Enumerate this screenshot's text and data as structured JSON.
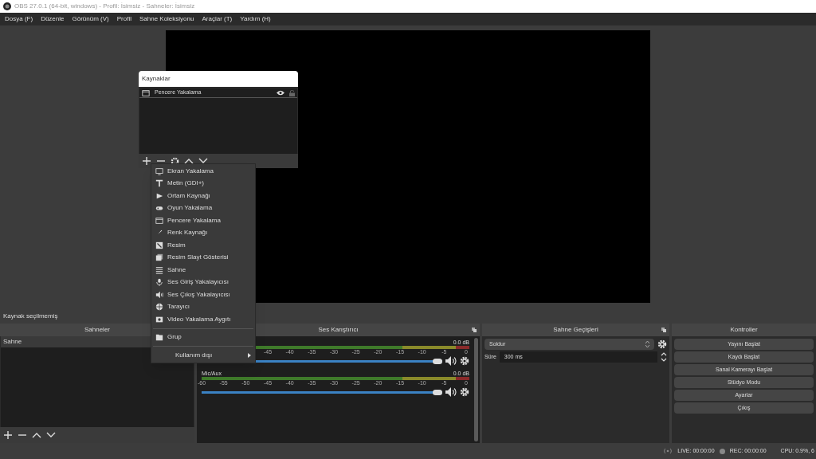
{
  "window": {
    "title": "OBS 27.0.1 (64-bit, windows) - Profil: İsimsiz - Sahneler: İsimsiz"
  },
  "menu_bar": [
    "Dosya (F)",
    "Düzenle",
    "Görünüm (V)",
    "Profil",
    "Sahne Koleksiyonu",
    "Araçlar (T)",
    "Yardım (H)"
  ],
  "sources_dock": {
    "title": "Kaynaklar",
    "items": [
      {
        "label": "Pencere Yakalama",
        "kind": "window",
        "visible": true,
        "locked": false
      }
    ]
  },
  "add_source_menu": {
    "items": [
      {
        "label": "Ekran Yakalama",
        "kind": "monitor"
      },
      {
        "label": "Metin (GDI+)",
        "kind": "text"
      },
      {
        "label": "Ortam Kaynağı",
        "kind": "play"
      },
      {
        "label": "Oyun Yakalama",
        "kind": "gamepad"
      },
      {
        "label": "Pencere Yakalama",
        "kind": "window"
      },
      {
        "label": "Renk Kaynağı",
        "kind": "brush"
      },
      {
        "label": "Resim",
        "kind": "image"
      },
      {
        "label": "Resim Slayt Gösterisi",
        "kind": "slides"
      },
      {
        "label": "Sahne",
        "kind": "list"
      },
      {
        "label": "Ses Giriş Yakalayıcısı",
        "kind": "mic"
      },
      {
        "label": "Ses Çıkış Yakalayıcısı",
        "kind": "speaker"
      },
      {
        "label": "Tarayıcı",
        "kind": "globe"
      },
      {
        "label": "Video Yakalama Aygıtı",
        "kind": "camera"
      },
      {
        "label": "Grup",
        "kind": "folder",
        "separator_before": true
      },
      {
        "label": "Kullanım dışı",
        "kind": "submenu",
        "separator_before": true
      }
    ]
  },
  "source_status": "Kaynak seçilmemiş",
  "scenes": {
    "title": "Sahneler",
    "items": [
      {
        "label": "Sahne",
        "selected": true
      }
    ]
  },
  "mixer": {
    "title": "Ses Karıştırıcı",
    "tracks": [
      {
        "peak": "0.0 dB",
        "ticks": [
          "-45",
          "-40",
          "-35",
          "-30",
          "-25",
          "-20",
          "-15",
          "-10",
          "-5",
          "0"
        ],
        "level": 1,
        "muted": false
      },
      {
        "name": "Mic/Aux",
        "peak": "0.0 dB",
        "ticks": [
          "-60",
          "-55",
          "-50",
          "-45",
          "-40",
          "-35",
          "-30",
          "-25",
          "-20",
          "-15",
          "-10",
          "-5",
          "0"
        ],
        "level": 1,
        "muted": false
      }
    ]
  },
  "transitions": {
    "title": "Sahne Geçişleri",
    "transition": "Soldur",
    "duration_label": "Süre",
    "duration": "300 ms"
  },
  "controls": {
    "title": "Kontroller",
    "buttons": [
      "Yayını Başlat",
      "Kaydı Başlat",
      "Sanal Kamerayı Başlat",
      "Stüdyo Modu",
      "Ayarlar",
      "Çıkış"
    ]
  },
  "status_bar": {
    "live": "LIVE: 00:00:00",
    "rec": "REC: 00:00:00",
    "cpu": "CPU: 0.9%, 6"
  }
}
